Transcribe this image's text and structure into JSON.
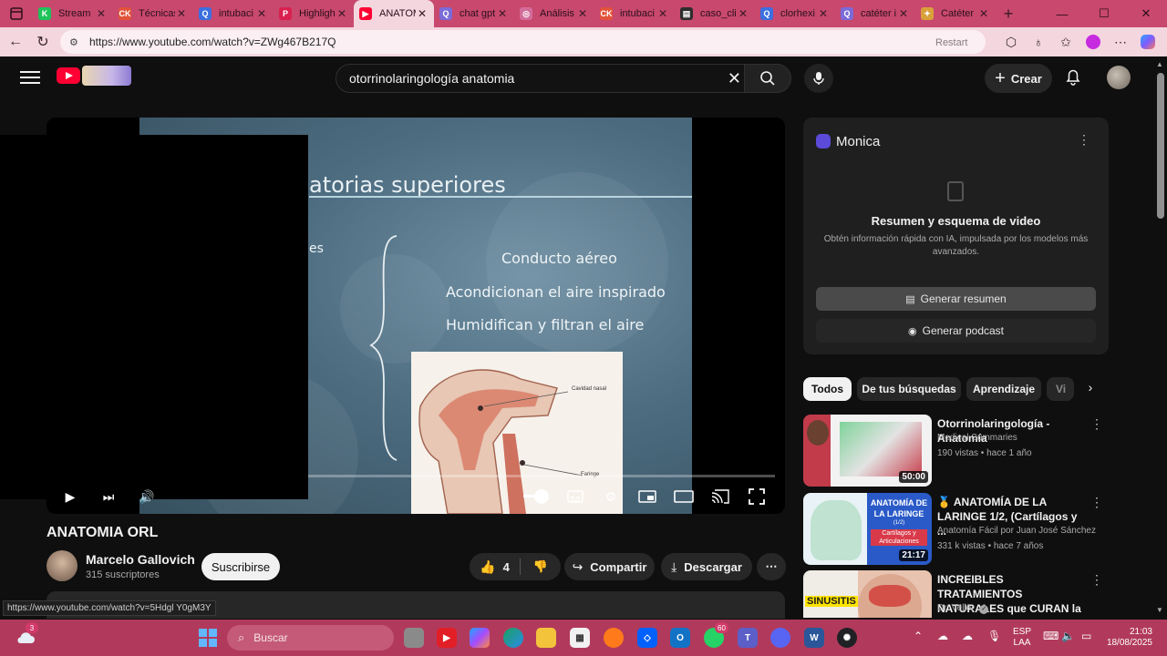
{
  "browser": {
    "tabs": [
      {
        "title": "Stream",
        "fav_color": "#1ec35a",
        "fav_glyph": "K"
      },
      {
        "title": "Técnicas",
        "fav_color": "#e2533a",
        "fav_glyph": "CK"
      },
      {
        "title": "intubaci",
        "fav_color": "#3b6fe0",
        "fav_glyph": "Q"
      },
      {
        "title": "Highlight",
        "fav_color": "#d9204f",
        "fav_glyph": "P"
      },
      {
        "title": "ANATOM",
        "fav_color": "#ff0033",
        "fav_glyph": "▶"
      },
      {
        "title": "chat gpt",
        "fav_color": "#7a6bd8",
        "fav_glyph": "Q"
      },
      {
        "title": "Análisis",
        "fav_color": "#d36c9a",
        "fav_glyph": "◎"
      },
      {
        "title": "intubaci",
        "fav_color": "#e2533a",
        "fav_glyph": "CK"
      },
      {
        "title": "caso_cli",
        "fav_color": "#2d2d2d",
        "fav_glyph": "▤"
      },
      {
        "title": "clorhexi",
        "fav_color": "#3b6fe0",
        "fav_glyph": "Q"
      },
      {
        "title": "catéter i",
        "fav_color": "#7a6bd8",
        "fav_glyph": "Q"
      },
      {
        "title": "Catéter",
        "fav_color": "#d9a13a",
        "fav_glyph": "✦"
      }
    ],
    "active_tab_index": 4,
    "url": "https://www.youtube.com/watch?v=ZWg467B217Q",
    "restart_label": "Restart"
  },
  "youtube": {
    "search_query": "otorrinolaringología anatomia",
    "create_label": "Crear"
  },
  "slide": {
    "title": "atorias superiores",
    "fragment_1": "es",
    "fragment_2": "",
    "items": [
      "Conducto aéreo",
      "Acondicionan  el aire inspirado",
      "Humidifican y filtran el aire"
    ],
    "diagram_label_1": "Cavidad nasal",
    "diagram_label_2": "Faringe"
  },
  "video": {
    "title": "ANATOMIA ORL",
    "channel": "Marcelo Gallovich",
    "subscribers": "315 suscriptores",
    "subscribe_label": "Suscribirse",
    "likes": "4",
    "share_label": "Compartir",
    "download_label": "Descargar",
    "hover_url": "https://www.youtube.com/watch?v=5Hdgl Y0gM3Y"
  },
  "monica": {
    "name": "Monica",
    "heading": "Resumen y esquema de video",
    "description": "Obtén información rápida con IA, impulsada por los modelos más avanzados.",
    "summary_button": "Generar resumen",
    "podcast_button": "Generar podcast"
  },
  "chips": [
    "Todos",
    "De tus búsquedas",
    "Aprendizaje",
    "Vi"
  ],
  "recommendations": [
    {
      "title": "Otorrinolaringología - Anatomía",
      "channel": "Medical Summaries",
      "meta": "190 vistas • hace 1 año",
      "duration": "50:00",
      "verified": false
    },
    {
      "title": "🥇 ANATOMÍA DE LA LARINGE 1/2, (Cartílagos y ...",
      "channel": "Anatomía Fácil por Juan José Sánchez",
      "meta": "331 k vistas • hace 7 años",
      "duration": "21:17",
      "verified": false
    },
    {
      "title": "INCREIBLES TRATAMIENTOS NATURALES que CURAN la ...",
      "channel": "Dr. Veller",
      "meta": "",
      "duration": "",
      "verified": true
    }
  ],
  "rec_thumb_text": {
    "laringe_1": "ANATOMÍA DE",
    "laringe_2": "LA LARINGE",
    "laringe_3": "(1/2)",
    "laringe_4": "Cartílagos y Articulaciones",
    "sinus": "SINUSITIS"
  },
  "taskbar": {
    "search_placeholder": "Buscar",
    "widget_badge": "3",
    "whatsapp_badge": "60",
    "language_1": "ESP",
    "language_2": "LAA",
    "time": "21:03",
    "date": "18/08/2025"
  }
}
